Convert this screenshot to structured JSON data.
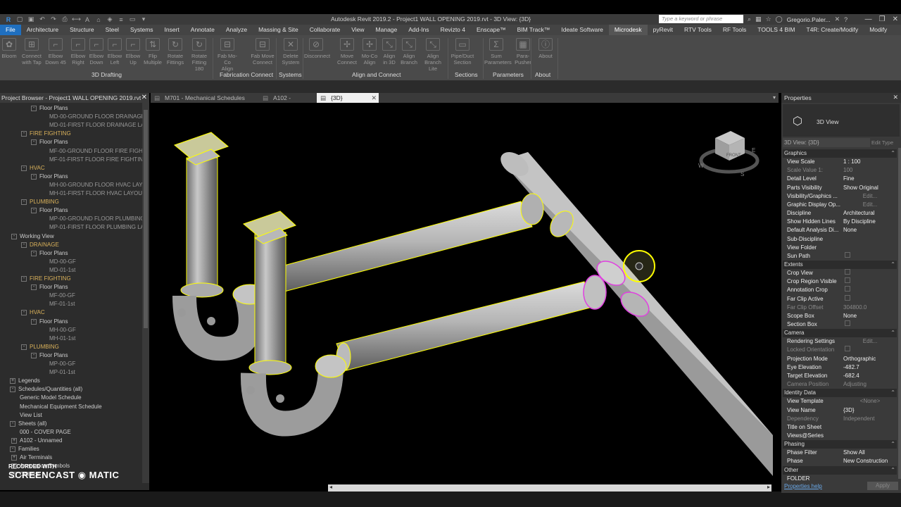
{
  "title": {
    "window_title": "Autodesk Revit 2019.2 - Project1 WALL OPENING 2019.rvt - 3D View: {3D}",
    "search_placeholder": "Type a keyword or phrase",
    "user": "Gregorio.Paler..."
  },
  "menu": [
    "File",
    "Architecture",
    "Structure",
    "Steel",
    "Systems",
    "Insert",
    "Annotate",
    "Analyze",
    "Massing & Site",
    "Collaborate",
    "View",
    "Manage",
    "Add-Ins",
    "Revizto 4",
    "Enscape™",
    "BIM Track™",
    "Ideate Software",
    "Microdesk",
    "pyRevit",
    "RTV Tools",
    "RF Tools",
    "TOOLS 4 BIM",
    "T4R: Create/Modify",
    "Modify"
  ],
  "menu_active": "Microdesk",
  "ribbon": {
    "buttons": [
      {
        "id": "bloom",
        "l1": "Bloom",
        "l2": ""
      },
      {
        "id": "connect-with-tap",
        "l1": "Connect",
        "l2": "with Tap"
      },
      {
        "id": "elbow-down-45",
        "l1": "Elbow",
        "l2": "Down 45"
      },
      {
        "id": "elbow-right",
        "l1": "Elbow",
        "l2": "Right"
      },
      {
        "id": "elbow-down",
        "l1": "Elbow",
        "l2": "Down"
      },
      {
        "id": "elbow-left",
        "l1": "Elbow",
        "l2": "Left"
      },
      {
        "id": "elbow-up",
        "l1": "Elbow",
        "l2": "Up"
      },
      {
        "id": "flip-multiple",
        "l1": "Flip",
        "l2": "Multiple"
      },
      {
        "id": "rotate-fittings",
        "l1": "Rotate",
        "l2": "Fittings"
      },
      {
        "id": "rotate-fitting-180",
        "l1": "Rotate",
        "l2": "Fitting 180"
      },
      {
        "id": "fab-mo-co-align",
        "l1": "Fab Mo-Co",
        "l2": "Align"
      },
      {
        "id": "fab-move-connect",
        "l1": "Fab Move",
        "l2": "Connect"
      },
      {
        "id": "delete-system",
        "l1": "Delete",
        "l2": "System"
      },
      {
        "id": "disconnect",
        "l1": "Disconnect",
        "l2": ""
      },
      {
        "id": "move-connect",
        "l1": "Move",
        "l2": "Connect"
      },
      {
        "id": "mo-co-align",
        "l1": "Mo-Co",
        "l2": "Align"
      },
      {
        "id": "align-in-3d",
        "l1": "Align",
        "l2": "in 3D"
      },
      {
        "id": "align-branch",
        "l1": "Align",
        "l2": "Branch"
      },
      {
        "id": "align-branch-lite",
        "l1": "Align",
        "l2": "Branch Lite"
      },
      {
        "id": "pipe-duct-section",
        "l1": "Pipe/Duct",
        "l2": "Section"
      },
      {
        "id": "sum-parameters",
        "l1": "Sum",
        "l2": "Parameters"
      },
      {
        "id": "para-pusher",
        "l1": "Para-",
        "l2": "Pusher"
      },
      {
        "id": "about-btn",
        "l1": "About",
        "l2": ""
      }
    ],
    "panels": [
      "3D Drafting",
      "Fabrication Connect",
      "Systems",
      "Align and Connect",
      "Sections",
      "Parameters",
      "About"
    ]
  },
  "project_browser": {
    "title": "Project Browser - Project1 WALL OPENING 2019.rvt",
    "rows": [
      {
        "text": "Floor Plans",
        "indent": 2,
        "kind": "group",
        "tog": "-"
      },
      {
        "text": "MD-00-GROUND FLOOR DRAINAGE",
        "indent": 3,
        "kind": "leaf"
      },
      {
        "text": "MD-01-FIRST FLOOR DRAINAGE LAY",
        "indent": 3,
        "kind": "leaf"
      },
      {
        "text": "FIRE FIGHTING",
        "indent": 1,
        "kind": "cat",
        "tog": "-"
      },
      {
        "text": "Floor Plans",
        "indent": 2,
        "kind": "group",
        "tog": "-"
      },
      {
        "text": "MF-00-GROUND FLOOR FIRE FIGHTI",
        "indent": 3,
        "kind": "leaf"
      },
      {
        "text": "MF-01-FIRST FLOOR FIRE FIGHTING",
        "indent": 3,
        "kind": "leaf"
      },
      {
        "text": "HVAC",
        "indent": 1,
        "kind": "cat",
        "tog": "-"
      },
      {
        "text": "Floor Plans",
        "indent": 2,
        "kind": "group",
        "tog": "-"
      },
      {
        "text": "MH-00-GROUND FLOOR HVAC LAYO",
        "indent": 3,
        "kind": "leaf"
      },
      {
        "text": "MH-01-FIRST FLOOR HVAC LAYOUT",
        "indent": 3,
        "kind": "leaf"
      },
      {
        "text": "PLUMBING",
        "indent": 1,
        "kind": "cat",
        "tog": "-"
      },
      {
        "text": "Floor Plans",
        "indent": 2,
        "kind": "group",
        "tog": "-"
      },
      {
        "text": "MP-00-GROUND FLOOR PLUMBING",
        "indent": 3,
        "kind": "leaf"
      },
      {
        "text": "MP-01-FIRST FLOOR PLUMBING LAY",
        "indent": 3,
        "kind": "leaf"
      },
      {
        "text": "Working View",
        "indent": 0,
        "kind": "group",
        "tog": "-"
      },
      {
        "text": "DRAINAGE",
        "indent": 1,
        "kind": "cat",
        "tog": "-"
      },
      {
        "text": "Floor Plans",
        "indent": 2,
        "kind": "group",
        "tog": "-"
      },
      {
        "text": "MD-00-GF",
        "indent": 3,
        "kind": "leaf"
      },
      {
        "text": "MD-01-1st",
        "indent": 3,
        "kind": "leaf"
      },
      {
        "text": "FIRE FIGHTING",
        "indent": 1,
        "kind": "cat",
        "tog": "-"
      },
      {
        "text": "Floor Plans",
        "indent": 2,
        "kind": "group",
        "tog": "-"
      },
      {
        "text": "MF-00-GF",
        "indent": 3,
        "kind": "leaf"
      },
      {
        "text": "MF-01-1st",
        "indent": 3,
        "kind": "leaf"
      },
      {
        "text": "HVAC",
        "indent": 1,
        "kind": "cat",
        "tog": "-"
      },
      {
        "text": "Floor Plans",
        "indent": 2,
        "kind": "group",
        "tog": "-"
      },
      {
        "text": "MH-00-GF",
        "indent": 3,
        "kind": "leaf"
      },
      {
        "text": "MH-01-1st",
        "indent": 3,
        "kind": "leaf"
      },
      {
        "text": "PLUMBING",
        "indent": 1,
        "kind": "cat",
        "tog": "-"
      },
      {
        "text": "Floor Plans",
        "indent": 2,
        "kind": "group",
        "tog": "-"
      },
      {
        "text": "MP-00-GF",
        "indent": 3,
        "kind": "leaf"
      },
      {
        "text": "MP-01-1st",
        "indent": 3,
        "kind": "leaf"
      },
      {
        "text": "Legends",
        "indent": -1,
        "kind": "group",
        "tog": "+"
      },
      {
        "text": "Schedules/Quantities (all)",
        "indent": -1,
        "kind": "group",
        "tog": "-"
      },
      {
        "text": "Generic Model Schedule",
        "indent": 0,
        "kind": "group"
      },
      {
        "text": "Mechanical Equipment Schedule",
        "indent": 0,
        "kind": "group"
      },
      {
        "text": "View List",
        "indent": 0,
        "kind": "group"
      },
      {
        "text": "Sheets (all)",
        "indent": -1,
        "kind": "group",
        "tog": "-"
      },
      {
        "text": "000 - COVER PAGE",
        "indent": 0,
        "kind": "group"
      },
      {
        "text": "A102 - Unnamed",
        "indent": 0,
        "kind": "group",
        "tog": "+"
      },
      {
        "text": "Families",
        "indent": -1,
        "kind": "group",
        "tog": "-"
      },
      {
        "text": "Air Terminals",
        "indent": 0,
        "kind": "group",
        "tog": "+"
      },
      {
        "text": "Annotation Symbols",
        "indent": 0,
        "kind": "group",
        "tog": "+"
      },
      {
        "text": "Ceilings",
        "indent": 0,
        "kind": "group",
        "tog": "+"
      }
    ]
  },
  "view_tabs": [
    {
      "label": "M701 - Mechanical Schedules",
      "active": false
    },
    {
      "label": "A102 - Unnamed",
      "active": false
    },
    {
      "label": "{3D}",
      "active": true
    }
  ],
  "viewcube": {
    "face": "FRONT",
    "compass": [
      "W",
      "S",
      "E"
    ]
  },
  "properties": {
    "title": "Properties",
    "type_label": "3D View",
    "instance_selector": "3D View: {3D}",
    "edit_type": "Edit Type",
    "help": "Properties help",
    "apply": "Apply",
    "rows": [
      {
        "kind": "sect",
        "name": "Graphics"
      },
      {
        "name": "View Scale",
        "value": "1 : 100"
      },
      {
        "name": "Scale Value   1:",
        "value": "100",
        "dim": true
      },
      {
        "name": "Detail Level",
        "value": "Fine"
      },
      {
        "name": "Parts Visibility",
        "value": "Show Original"
      },
      {
        "name": "Visibility/Graphics ...",
        "value": "Edit...",
        "btn": true
      },
      {
        "name": "Graphic Display Op...",
        "value": "Edit...",
        "btn": true
      },
      {
        "name": "Discipline",
        "value": "Architectural"
      },
      {
        "name": "Show Hidden Lines",
        "value": "By Discipline"
      },
      {
        "name": "Default Analysis Di...",
        "value": "None"
      },
      {
        "name": "Sub-Discipline",
        "value": ""
      },
      {
        "name": "View Folder",
        "value": ""
      },
      {
        "name": "Sun Path",
        "value": "",
        "cb": true
      },
      {
        "kind": "sect",
        "name": "Extents"
      },
      {
        "name": "Crop View",
        "value": "",
        "cb": true
      },
      {
        "name": "Crop Region Visible",
        "value": "",
        "cb": true
      },
      {
        "name": "Annotation Crop",
        "value": "",
        "cb": true
      },
      {
        "name": "Far Clip Active",
        "value": "",
        "cb": true
      },
      {
        "name": "Far Clip Offset",
        "value": "304800.0",
        "dim": true
      },
      {
        "name": "Scope Box",
        "value": "None"
      },
      {
        "name": "Section Box",
        "value": "",
        "cb": true
      },
      {
        "kind": "sect",
        "name": "Camera"
      },
      {
        "name": "Rendering Settings",
        "value": "Edit...",
        "btn": true
      },
      {
        "name": "Locked Orientation",
        "value": "",
        "dim": true,
        "cb": true
      },
      {
        "name": "Projection Mode",
        "value": "Orthographic"
      },
      {
        "name": "Eye Elevation",
        "value": "-482.7"
      },
      {
        "name": "Target Elevation",
        "value": "-682.4"
      },
      {
        "name": "Camera Position",
        "value": "Adjusting",
        "dim": true
      },
      {
        "kind": "sect",
        "name": "Identity Data"
      },
      {
        "name": "View Template",
        "value": "<None>",
        "btn": true
      },
      {
        "name": "View Name",
        "value": "{3D}"
      },
      {
        "name": "Dependency",
        "value": "Independent",
        "dim": true
      },
      {
        "name": "Title on Sheet",
        "value": ""
      },
      {
        "name": "Views@Series",
        "value": ""
      },
      {
        "kind": "sect",
        "name": "Phasing"
      },
      {
        "name": "Phase Filter",
        "value": "Show All"
      },
      {
        "name": "Phase",
        "value": "New Construction"
      },
      {
        "kind": "sect",
        "name": "Other"
      },
      {
        "name": "FOLDER",
        "value": ""
      }
    ]
  },
  "watermark": {
    "line1": "RECORDED WITH",
    "line2": "SCREENCAST ◉ MATIC"
  },
  "colors": {
    "selection": "#ffff00",
    "highlight": "#e040e0",
    "pipe": "#a9a9a9"
  }
}
